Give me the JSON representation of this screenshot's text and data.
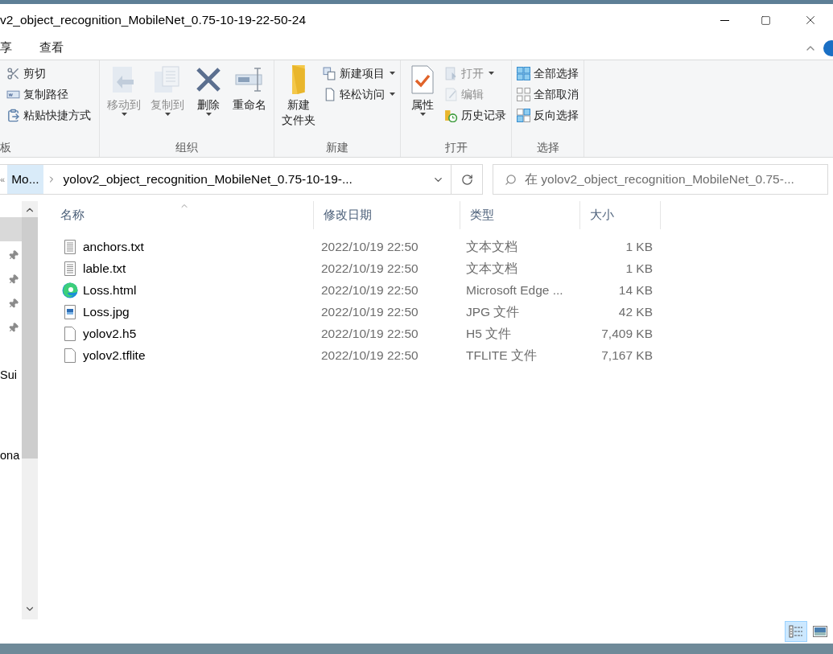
{
  "window": {
    "title": "v2_object_recognition_MobileNet_0.75-10-19-22-50-24"
  },
  "ribbon_tabs": [
    {
      "label": "享"
    },
    {
      "label": "查看"
    }
  ],
  "ribbon_groups": [
    {
      "label": "板",
      "items": [
        {
          "label": "剪切",
          "kind": "small",
          "disabled": false,
          "dropdown": false
        },
        {
          "label": "复制路径",
          "kind": "small",
          "disabled": false,
          "dropdown": false
        },
        {
          "label": "粘贴快捷方式",
          "kind": "small",
          "disabled": false,
          "dropdown": false
        }
      ]
    },
    {
      "label": "组织",
      "items": [
        {
          "label": "移动到",
          "kind": "large",
          "disabled": true,
          "dropdown": true
        },
        {
          "label": "复制到",
          "kind": "large",
          "disabled": true,
          "dropdown": true
        },
        {
          "label": "删除",
          "kind": "large",
          "disabled": false,
          "dropdown": true
        },
        {
          "label": "重命名",
          "kind": "large",
          "disabled": false,
          "dropdown": false
        }
      ]
    },
    {
      "label": "新建",
      "items": [
        {
          "label": [
            "新建",
            "文件夹"
          ],
          "kind": "large",
          "disabled": false,
          "dropdown": false
        },
        {
          "label": "新建项目",
          "kind": "small",
          "disabled": false,
          "dropdown": true
        },
        {
          "label": "轻松访问",
          "kind": "small",
          "disabled": false,
          "dropdown": true
        }
      ]
    },
    {
      "label": "打开",
      "items": [
        {
          "label": "属性",
          "kind": "large",
          "disabled": false,
          "dropdown": true
        },
        {
          "label": "打开",
          "kind": "small",
          "disabled": true,
          "dropdown": true
        },
        {
          "label": "编辑",
          "kind": "small",
          "disabled": true,
          "dropdown": false
        },
        {
          "label": "历史记录",
          "kind": "small",
          "disabled": false,
          "dropdown": false
        }
      ]
    },
    {
      "label": "选择",
      "items": [
        {
          "label": "全部选择",
          "kind": "small",
          "disabled": false,
          "dropdown": false
        },
        {
          "label": "全部取消",
          "kind": "small",
          "disabled": false,
          "dropdown": false
        },
        {
          "label": "反向选择",
          "kind": "small",
          "disabled": false,
          "dropdown": false
        }
      ]
    }
  ],
  "address_bar": {
    "overflow": "«",
    "breadcrumbs": [
      {
        "label": "Mo...",
        "selected": true
      },
      {
        "label": "yolov2_object_recognition_MobileNet_0.75-10-19-...",
        "selected": false
      }
    ]
  },
  "search": {
    "placeholder": "在 yolov2_object_recognition_MobileNet_0.75-..."
  },
  "nav_pane": {
    "items": [
      {
        "selected": true,
        "pinned": false
      },
      {
        "selected": false,
        "pinned": true
      },
      {
        "selected": false,
        "pinned": true
      },
      {
        "selected": false,
        "pinned": true
      },
      {
        "selected": false,
        "pinned": true
      },
      {
        "label": "Sui",
        "selected": false,
        "pinned": false
      },
      {
        "label": "ona",
        "selected": false,
        "pinned": false
      }
    ]
  },
  "file_list": {
    "columns": [
      "名称",
      "修改日期",
      "类型",
      "大小"
    ],
    "rows": [
      {
        "kind": "text",
        "name": "anchors.txt",
        "modified": "2022/10/19 22:50",
        "type": "文本文档",
        "size": "1 KB"
      },
      {
        "kind": "text",
        "name": "lable.txt",
        "modified": "2022/10/19 22:50",
        "type": "文本文档",
        "size": "1 KB"
      },
      {
        "kind": "edge",
        "name": "Loss.html",
        "modified": "2022/10/19 22:50",
        "type": "Microsoft Edge ...",
        "size": "14 KB"
      },
      {
        "kind": "image",
        "name": "Loss.jpg",
        "modified": "2022/10/19 22:50",
        "type": "JPG 文件",
        "size": "42 KB"
      },
      {
        "kind": "blank",
        "name": "yolov2.h5",
        "modified": "2022/10/19 22:50",
        "type": "H5 文件",
        "size": "7,409 KB"
      },
      {
        "kind": "blank",
        "name": "yolov2.tflite",
        "modified": "2022/10/19 22:50",
        "type": "TFLITE 文件",
        "size": "7,167 KB"
      }
    ]
  },
  "view_buttons": [
    {
      "kind": "details",
      "selected": true
    },
    {
      "kind": "large-icons",
      "selected": false
    }
  ]
}
